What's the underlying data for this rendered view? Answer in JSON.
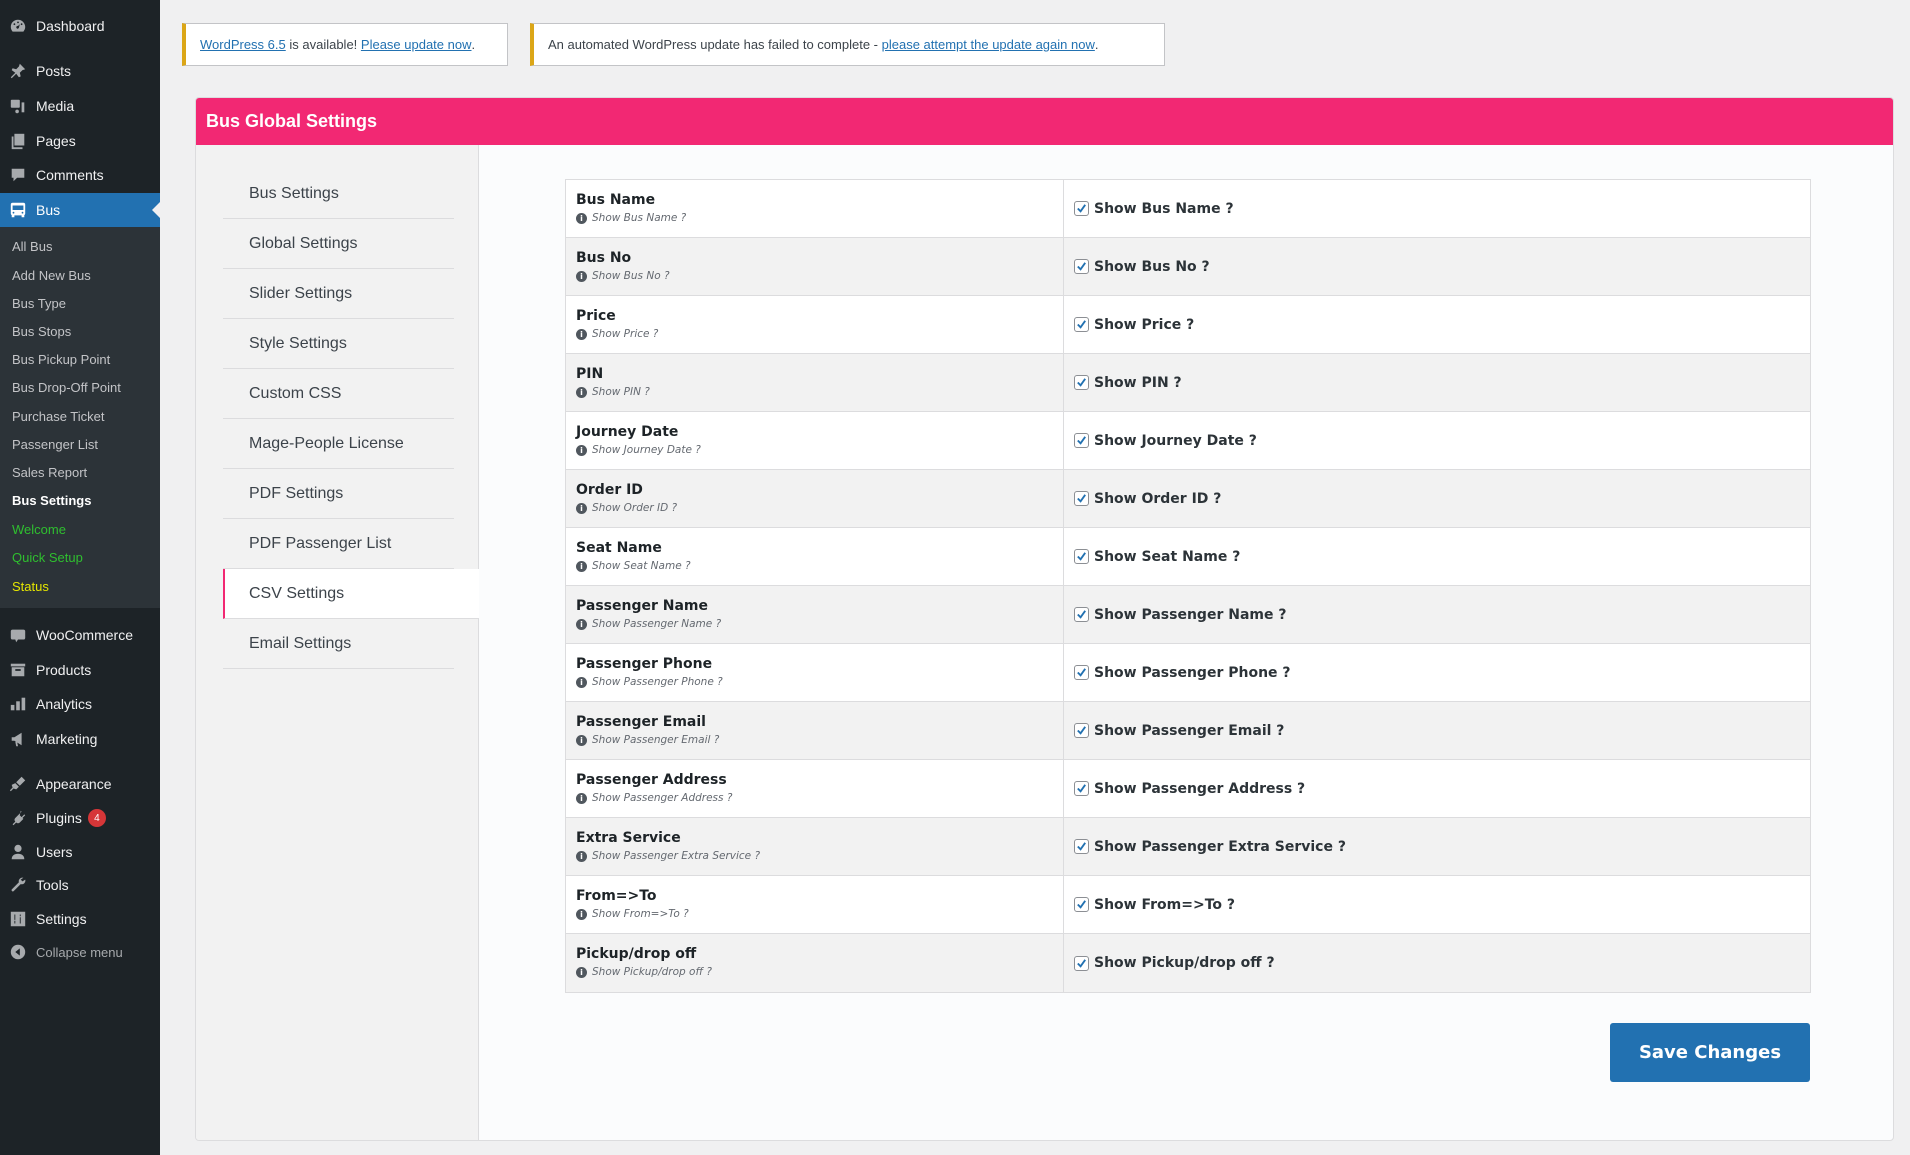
{
  "admin_menu": {
    "items": [
      {
        "label": "Dashboard",
        "icon": "dashboard-icon"
      },
      {
        "label": "Posts",
        "icon": "pin-icon"
      },
      {
        "label": "Media",
        "icon": "media-icon"
      },
      {
        "label": "Pages",
        "icon": "pages-icon"
      },
      {
        "label": "Comments",
        "icon": "comment-icon"
      },
      {
        "label": "Bus",
        "icon": "bus-icon"
      },
      {
        "label": "WooCommerce",
        "icon": "woo-icon"
      },
      {
        "label": "Products",
        "icon": "archive-icon"
      },
      {
        "label": "Analytics",
        "icon": "bar-chart-icon"
      },
      {
        "label": "Marketing",
        "icon": "megaphone-icon"
      },
      {
        "label": "Appearance",
        "icon": "brush-icon"
      },
      {
        "label": "Plugins",
        "icon": "plug-icon",
        "badge": "4"
      },
      {
        "label": "Users",
        "icon": "user-icon"
      },
      {
        "label": "Tools",
        "icon": "wrench-icon"
      },
      {
        "label": "Settings",
        "icon": "sliders-icon"
      }
    ],
    "bus_submenu": [
      "All Bus",
      "Add New Bus",
      "Bus Type",
      "Bus Stops",
      "Bus Pickup Point",
      "Bus Drop-Off Point",
      "Purchase Ticket",
      "Passenger List",
      "Sales Report",
      "Bus Settings",
      "Welcome",
      "Quick Setup",
      "Status"
    ],
    "collapse_label": "Collapse menu"
  },
  "notices": {
    "update_link": "WordPress 6.5",
    "update_text": " is available! ",
    "update_now_link": "Please update now",
    "update_end": ".",
    "failed_text": "An automated WordPress update has failed to complete - ",
    "failed_link": "please attempt the update again now",
    "failed_end": "."
  },
  "page": {
    "title": "Bus Global Settings",
    "accent_color": "#f22873",
    "tabs": [
      "Bus Settings",
      "Global Settings",
      "Slider Settings",
      "Style Settings",
      "Custom CSS",
      "Mage-People License",
      "PDF Settings",
      "PDF Passenger List",
      "CSV Settings",
      "Email Settings"
    ],
    "active_tab": "CSV Settings",
    "rows": [
      {
        "title": "Bus Name",
        "hint": "Show Bus Name ?",
        "option": "Show Bus Name ?",
        "checked": true
      },
      {
        "title": "Bus No",
        "hint": "Show Bus No ?",
        "option": "Show Bus No ?",
        "checked": true
      },
      {
        "title": "Price",
        "hint": "Show Price ?",
        "option": "Show Price ?",
        "checked": true
      },
      {
        "title": "PIN",
        "hint": "Show PIN ?",
        "option": "Show PIN ?",
        "checked": true
      },
      {
        "title": "Journey Date",
        "hint": "Show Journey Date ?",
        "option": "Show Journey Date ?",
        "checked": true
      },
      {
        "title": "Order ID",
        "hint": "Show Order ID ?",
        "option": "Show Order ID ?",
        "checked": true
      },
      {
        "title": "Seat Name",
        "hint": "Show Seat Name ?",
        "option": "Show Seat Name ?",
        "checked": true
      },
      {
        "title": "Passenger Name",
        "hint": "Show Passenger Name ?",
        "option": "Show Passenger Name ?",
        "checked": true
      },
      {
        "title": "Passenger Phone",
        "hint": "Show Passenger Phone ?",
        "option": "Show Passenger Phone ?",
        "checked": true
      },
      {
        "title": "Passenger Email",
        "hint": "Show Passenger Email ?",
        "option": "Show Passenger Email ?",
        "checked": true
      },
      {
        "title": "Passenger Address",
        "hint": "Show Passenger Address ?",
        "option": "Show Passenger Address ?",
        "checked": true
      },
      {
        "title": "Extra Service",
        "hint": "Show Passenger Extra Service ?",
        "option": "Show Passenger Extra Service ?",
        "checked": true
      },
      {
        "title": "From=>To",
        "hint": "Show From=>To ?",
        "option": "Show From=>To ?",
        "checked": true
      },
      {
        "title": "Pickup/drop off",
        "hint": "Show Pickup/drop off ?",
        "option": "Show Pickup/drop off ?",
        "checked": true
      }
    ],
    "save_label": "Save Changes"
  }
}
